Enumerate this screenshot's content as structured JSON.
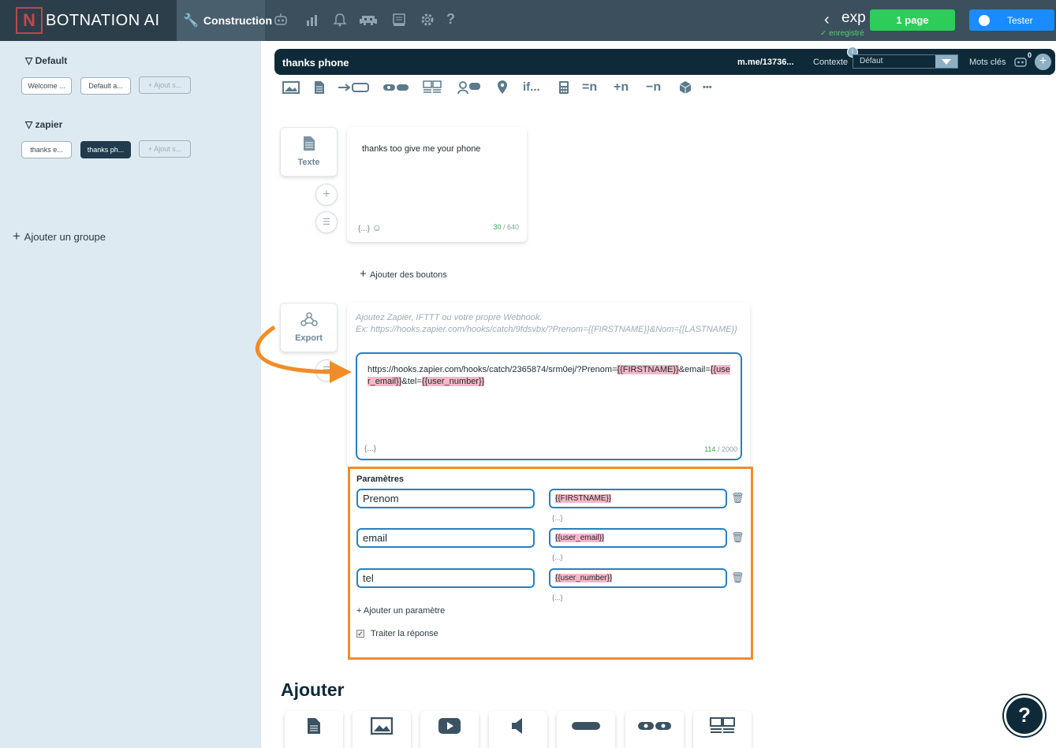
{
  "app": {
    "brand": "BOTNATION AI",
    "brand_mark": "N",
    "nav_active": "Construction",
    "nav_icons": [
      "robot-icon",
      "chart-icon",
      "bell-icon",
      "invader-icon",
      "inbox-icon",
      "gear-icon",
      "help-question-icon"
    ],
    "project": "exp",
    "saved_status": "✓ enregistré",
    "publish_button": "1 page",
    "test_button": "Tester"
  },
  "sidebar": {
    "groups": [
      {
        "title": "Default",
        "items": [
          "Welcome ...",
          "Default a...",
          "+ Ajout s..."
        ]
      },
      {
        "title": "zapier",
        "items": [
          "thanks e...",
          "thanks ph...",
          "+ Ajout s..."
        ]
      }
    ],
    "add_group": "Ajouter un groupe"
  },
  "scenario": {
    "title": "thanks phone",
    "link": "m.me/13736...",
    "context_label": "Contexte",
    "context_value": "Défaut",
    "keywords_label": "Mots clés",
    "keywords_count": "0",
    "info": "i"
  },
  "toolbar": {
    "if_label": "if...",
    "set_label": "=n",
    "inc_label": "+n",
    "dec_label": "−n",
    "more_label": "•••"
  },
  "text_block": {
    "type_label": "Texte",
    "message": "thanks too give me your phone",
    "vars": "{...}",
    "count_used": "30",
    "count_max": "/ 640",
    "add_buttons": "Ajouter des boutons"
  },
  "export_block": {
    "type_label": "Export",
    "help_line1": "Ajoutez Zapier, IFTTT ou votre propre Webhook.",
    "help_line2": "Ex: https://hooks.zapier.com/hooks/catch/9fdsvbx/?Prenom={{FIRSTNAME}}&Nom={{LASTNAME}}",
    "url_part1": "https://hooks.zapier.com/hooks/catch/2365874/srm0ej/?Prenom=",
    "url_var1": "{{FIRSTNAME}}",
    "url_part2": "&email=",
    "url_var2": "{{user_email}}",
    "url_part3": "&tel=",
    "url_var3": "{{user_number}}",
    "vars": "{...}",
    "count_used": "114",
    "count_max": "/ 2000"
  },
  "params": {
    "title": "Paramètres",
    "rows": [
      {
        "key": "Prenom",
        "value": "{{FIRSTNAME}}",
        "vars": "{...}"
      },
      {
        "key": "email",
        "value": "{{user_email}}",
        "vars": "{...}"
      },
      {
        "key": "tel",
        "value": "{{user_number}}",
        "vars": "{...}"
      }
    ],
    "add_param": "+ Ajouter un paramètre",
    "treat_response": "Traiter la réponse",
    "treat_checked": true
  },
  "add_section": {
    "title": "Ajouter"
  },
  "colors": {
    "topbar": "#3b4f5c",
    "sidebar": "#deeaf1",
    "scenario_bar": "#0e2a38",
    "highlight_border": "#f28c28",
    "field_border": "#2680c2",
    "variable_highlight": "#f6b7c6",
    "publish": "#2ecc5a",
    "test": "#1a8cff"
  }
}
